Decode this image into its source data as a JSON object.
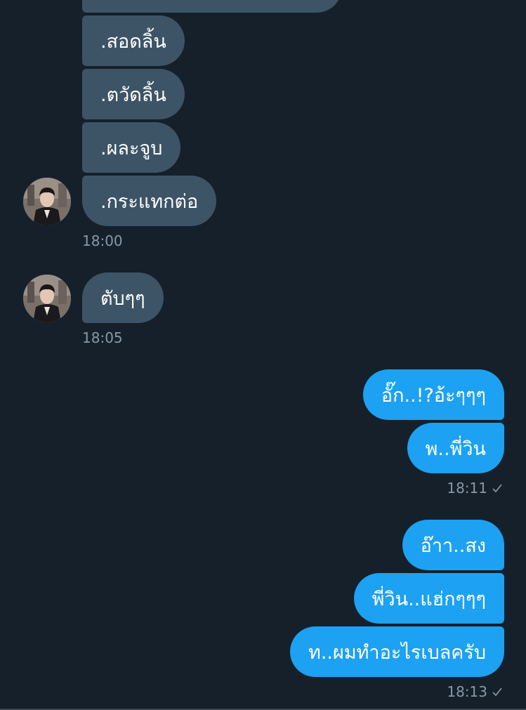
{
  "messages": {
    "received": [
      {
        "text": ".สอดลิ้น"
      },
      {
        "text": ".ตวัดลิ้น"
      },
      {
        "text": ".ผละจูบ"
      },
      {
        "text": ".กระแทกต่อ"
      },
      {
        "text": "ตับๆๆ"
      }
    ],
    "sent": [
      {
        "text": "อั๊ก..!?อ้ะๆๆๆ"
      },
      {
        "text": "พ..พี่วิน"
      },
      {
        "text": "อ๊าา..สง"
      },
      {
        "text": "พี่วิน..แฮ่กๆๆๆ"
      },
      {
        "text": "ท..ผมทำอะไรเบลครับ"
      }
    ]
  },
  "timestamps": {
    "t1": "18:00",
    "t2": "18:05",
    "t3": "18:11",
    "t4": "18:13"
  },
  "status_icon": "check-icon",
  "colors": {
    "background": "#15202b",
    "received_bubble": "#3d5466",
    "sent_bubble": "#1da1f2",
    "timestamp": "#8899a6"
  }
}
